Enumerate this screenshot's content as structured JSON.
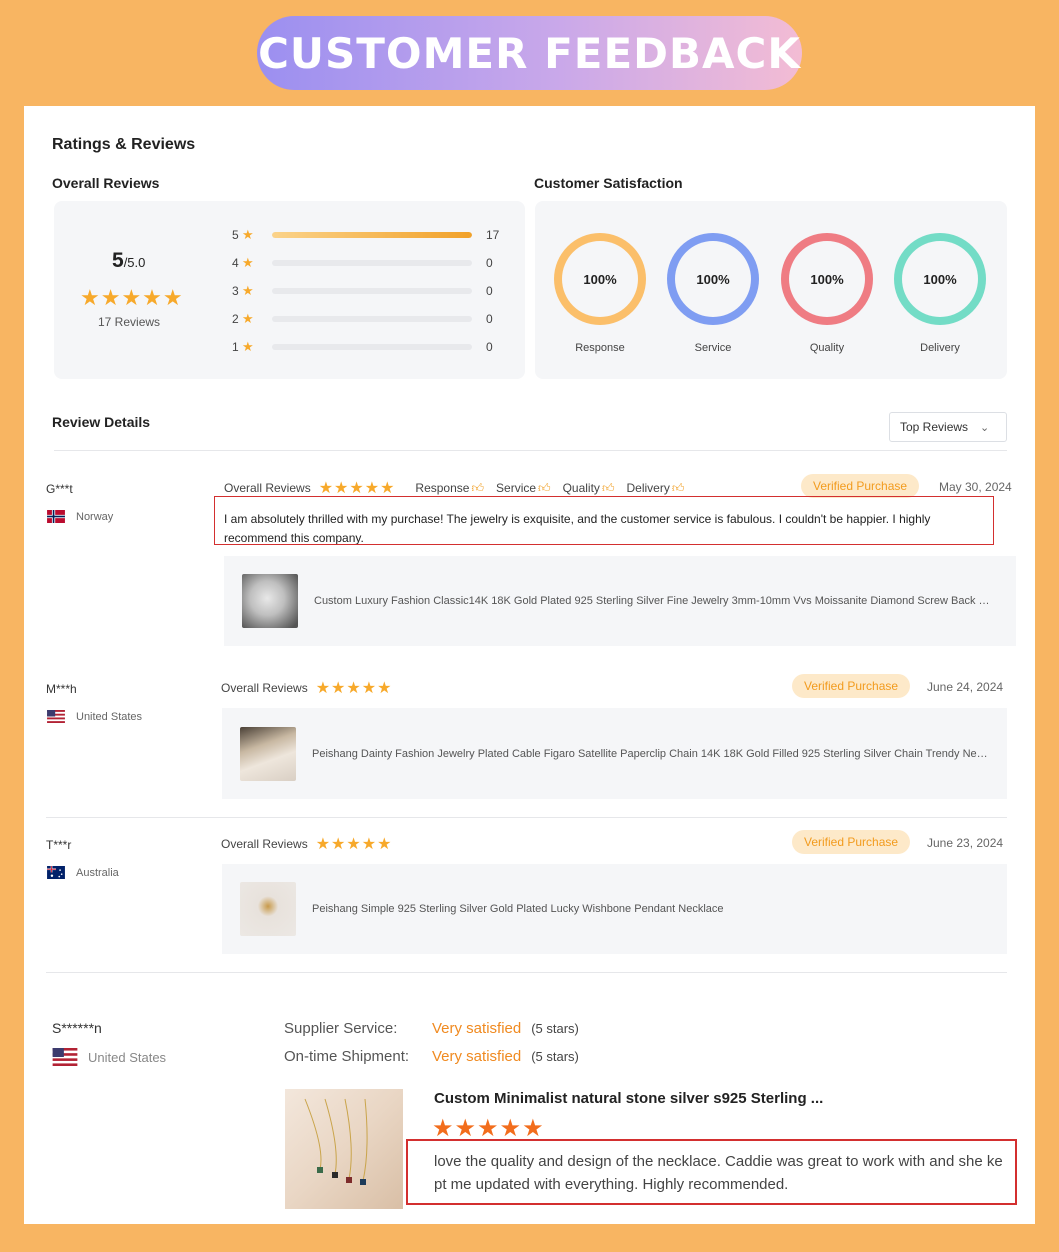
{
  "banner_title": "CUSTOMER FEEDBACK",
  "ratings": {
    "heading": "Ratings & Reviews",
    "overall_heading": "Overall Reviews",
    "score": "5",
    "score_suffix": "/5.0",
    "stars": "★★★★★",
    "reviews_count_label": "17 Reviews",
    "distribution": [
      {
        "label": "5",
        "fill_fraction": 1.0,
        "count": "17"
      },
      {
        "label": "4",
        "fill_fraction": 0,
        "count": "0"
      },
      {
        "label": "3",
        "fill_fraction": 0,
        "count": "0"
      },
      {
        "label": "2",
        "fill_fraction": 0,
        "count": "0"
      },
      {
        "label": "1",
        "fill_fraction": 0,
        "count": "0"
      }
    ],
    "satisfaction_heading": "Customer Satisfaction",
    "satisfaction": [
      {
        "value": "100%",
        "label": "Response",
        "color": "#fbbf6a"
      },
      {
        "value": "100%",
        "label": "Service",
        "color": "#7f9df2"
      },
      {
        "value": "100%",
        "label": "Quality",
        "color": "#ef7c83"
      },
      {
        "value": "100%",
        "label": "Delivery",
        "color": "#73dcc6"
      }
    ]
  },
  "review_details": {
    "heading": "Review Details",
    "sort_label": "Top Reviews",
    "sort_icon": "chevron-down-icon"
  },
  "colors": {
    "accent": "#f7a92b",
    "badge_bg": "#fde9c9",
    "badge_text": "#f29b1e",
    "highlight": "#d32f2f"
  },
  "reviews": [
    {
      "name": "G***t",
      "country": "Norway",
      "overall_label": "Overall Reviews",
      "stars": "★★★★★",
      "tags": [
        "Response",
        "Service",
        "Quality",
        "Delivery"
      ],
      "badge": "Verified Purchase",
      "date": "May 30, 2024",
      "text": "I am absolutely thrilled with my purchase! The jewelry is exquisite, and the customer service is fabulous. I couldn't be happier. I highly recommend this company.",
      "product": "Custom Luxury Fashion Classic14K 18K Gold Plated 925 Sterling Silver Fine Jewelry 3mm-10mm Vvs Moissanite Diamond Screw Back Stud Earrings"
    },
    {
      "name": "M***h",
      "country": "United States",
      "overall_label": "Overall Reviews",
      "stars": "★★★★★",
      "badge": "Verified Purchase",
      "date": "June 24, 2024",
      "product": "Peishang Dainty Fashion Jewelry Plated Cable Figaro Satellite Paperclip Chain 14K 18K Gold Filled 925 Sterling Silver Chain Trendy Necklace"
    },
    {
      "name": "T***r",
      "country": "Australia",
      "overall_label": "Overall Reviews",
      "stars": "★★★★★",
      "badge": "Verified Purchase",
      "date": "June 23, 2024",
      "product": "Peishang Simple 925 Sterling Silver Gold Plated Lucky Wishbone Pendant Necklace"
    }
  ],
  "supplier_review": {
    "name": "S******n",
    "country": "United States",
    "rows": [
      {
        "key": "Supplier Service:",
        "value": "Very satisfied",
        "note": "(5 stars)"
      },
      {
        "key": "On-time Shipment:",
        "value": "Very satisfied",
        "note": "(5 stars)"
      }
    ],
    "product_title": "Custom Minimalist natural stone silver s925 Sterling ...",
    "stars": "★★★★★",
    "text": "love the quality and design of the necklace. Caddie was great to work with and she kept me updated with everything. Highly recommended."
  }
}
